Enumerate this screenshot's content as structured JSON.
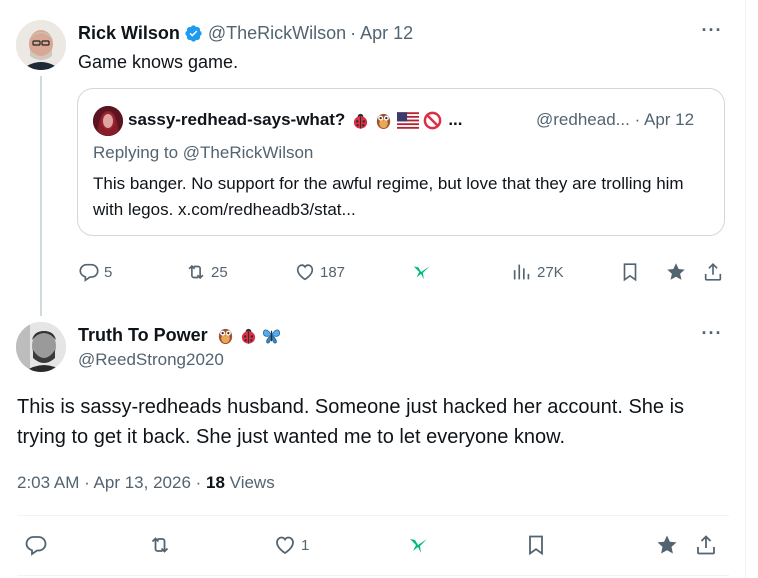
{
  "tweet1": {
    "author_name": "Rick Wilson",
    "handle": "@TheRickWilson",
    "separator": "·",
    "date": "Apr 12",
    "text": "Game knows game.",
    "quote": {
      "author_name": "sassy-redhead-says-what?",
      "emojis": [
        "ladybug-emoji",
        "owl-emoji",
        "us-flag-emoji",
        "prohibited-emoji"
      ],
      "ellipsis": "...",
      "handle": "@redhead...",
      "date": "· Apr 12",
      "replying_to": "Replying to @TheRickWilson",
      "text": "This banger. No support for the awful regime, but love that they are trolling him with legos. x.com/redheadb3/stat..."
    },
    "actions": {
      "replies": "5",
      "reposts": "25",
      "likes": "187",
      "views": "27K"
    }
  },
  "tweet2": {
    "author_name": "Truth To Power",
    "emojis": [
      "owl-emoji",
      "ladybug-emoji",
      "butterfly-emoji"
    ],
    "handle": "@ReedStrong2020",
    "text": "This is sassy-redheads husband. Someone just hacked her account. She is trying to get it back. She just wanted me to let everyone know.",
    "timestamp": "2:03 AM · Apr 13, 2026 · ",
    "views_count": "18",
    "views_label": " Views",
    "actions": {
      "likes": "1"
    }
  },
  "colors": {
    "muted": "#536471",
    "verified": "#1d9bf0",
    "grok": "#00ba7c",
    "border": "#cfd9de"
  }
}
